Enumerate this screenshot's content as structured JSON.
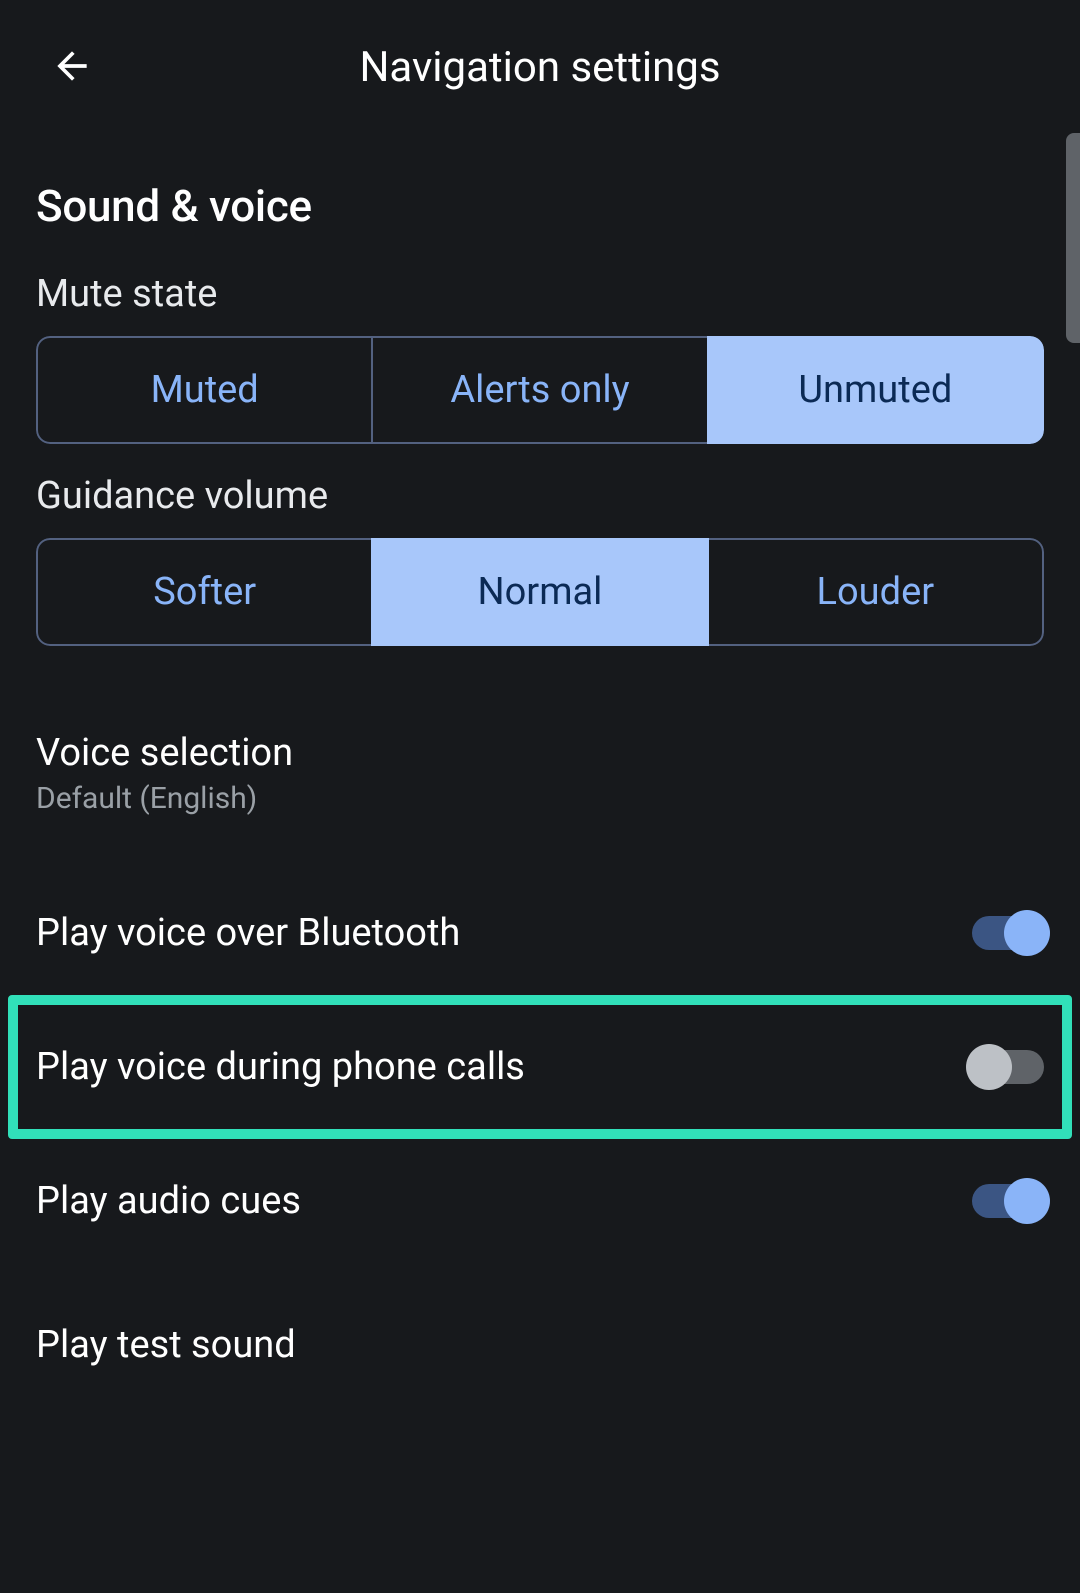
{
  "header": {
    "title": "Navigation settings"
  },
  "section": {
    "title": "Sound & voice"
  },
  "mute_state": {
    "label": "Mute state",
    "options": [
      "Muted",
      "Alerts only",
      "Unmuted"
    ],
    "selected": "Unmuted"
  },
  "guidance_volume": {
    "label": "Guidance volume",
    "options": [
      "Softer",
      "Normal",
      "Louder"
    ],
    "selected": "Normal"
  },
  "voice_selection": {
    "title": "Voice selection",
    "value": "Default (English)"
  },
  "rows": {
    "bluetooth": {
      "label": "Play voice over Bluetooth",
      "on": true
    },
    "phone_calls": {
      "label": "Play voice during phone calls",
      "on": false,
      "highlighted": true
    },
    "audio_cues": {
      "label": "Play audio cues",
      "on": true
    },
    "test_sound": {
      "label": "Play test sound"
    }
  }
}
